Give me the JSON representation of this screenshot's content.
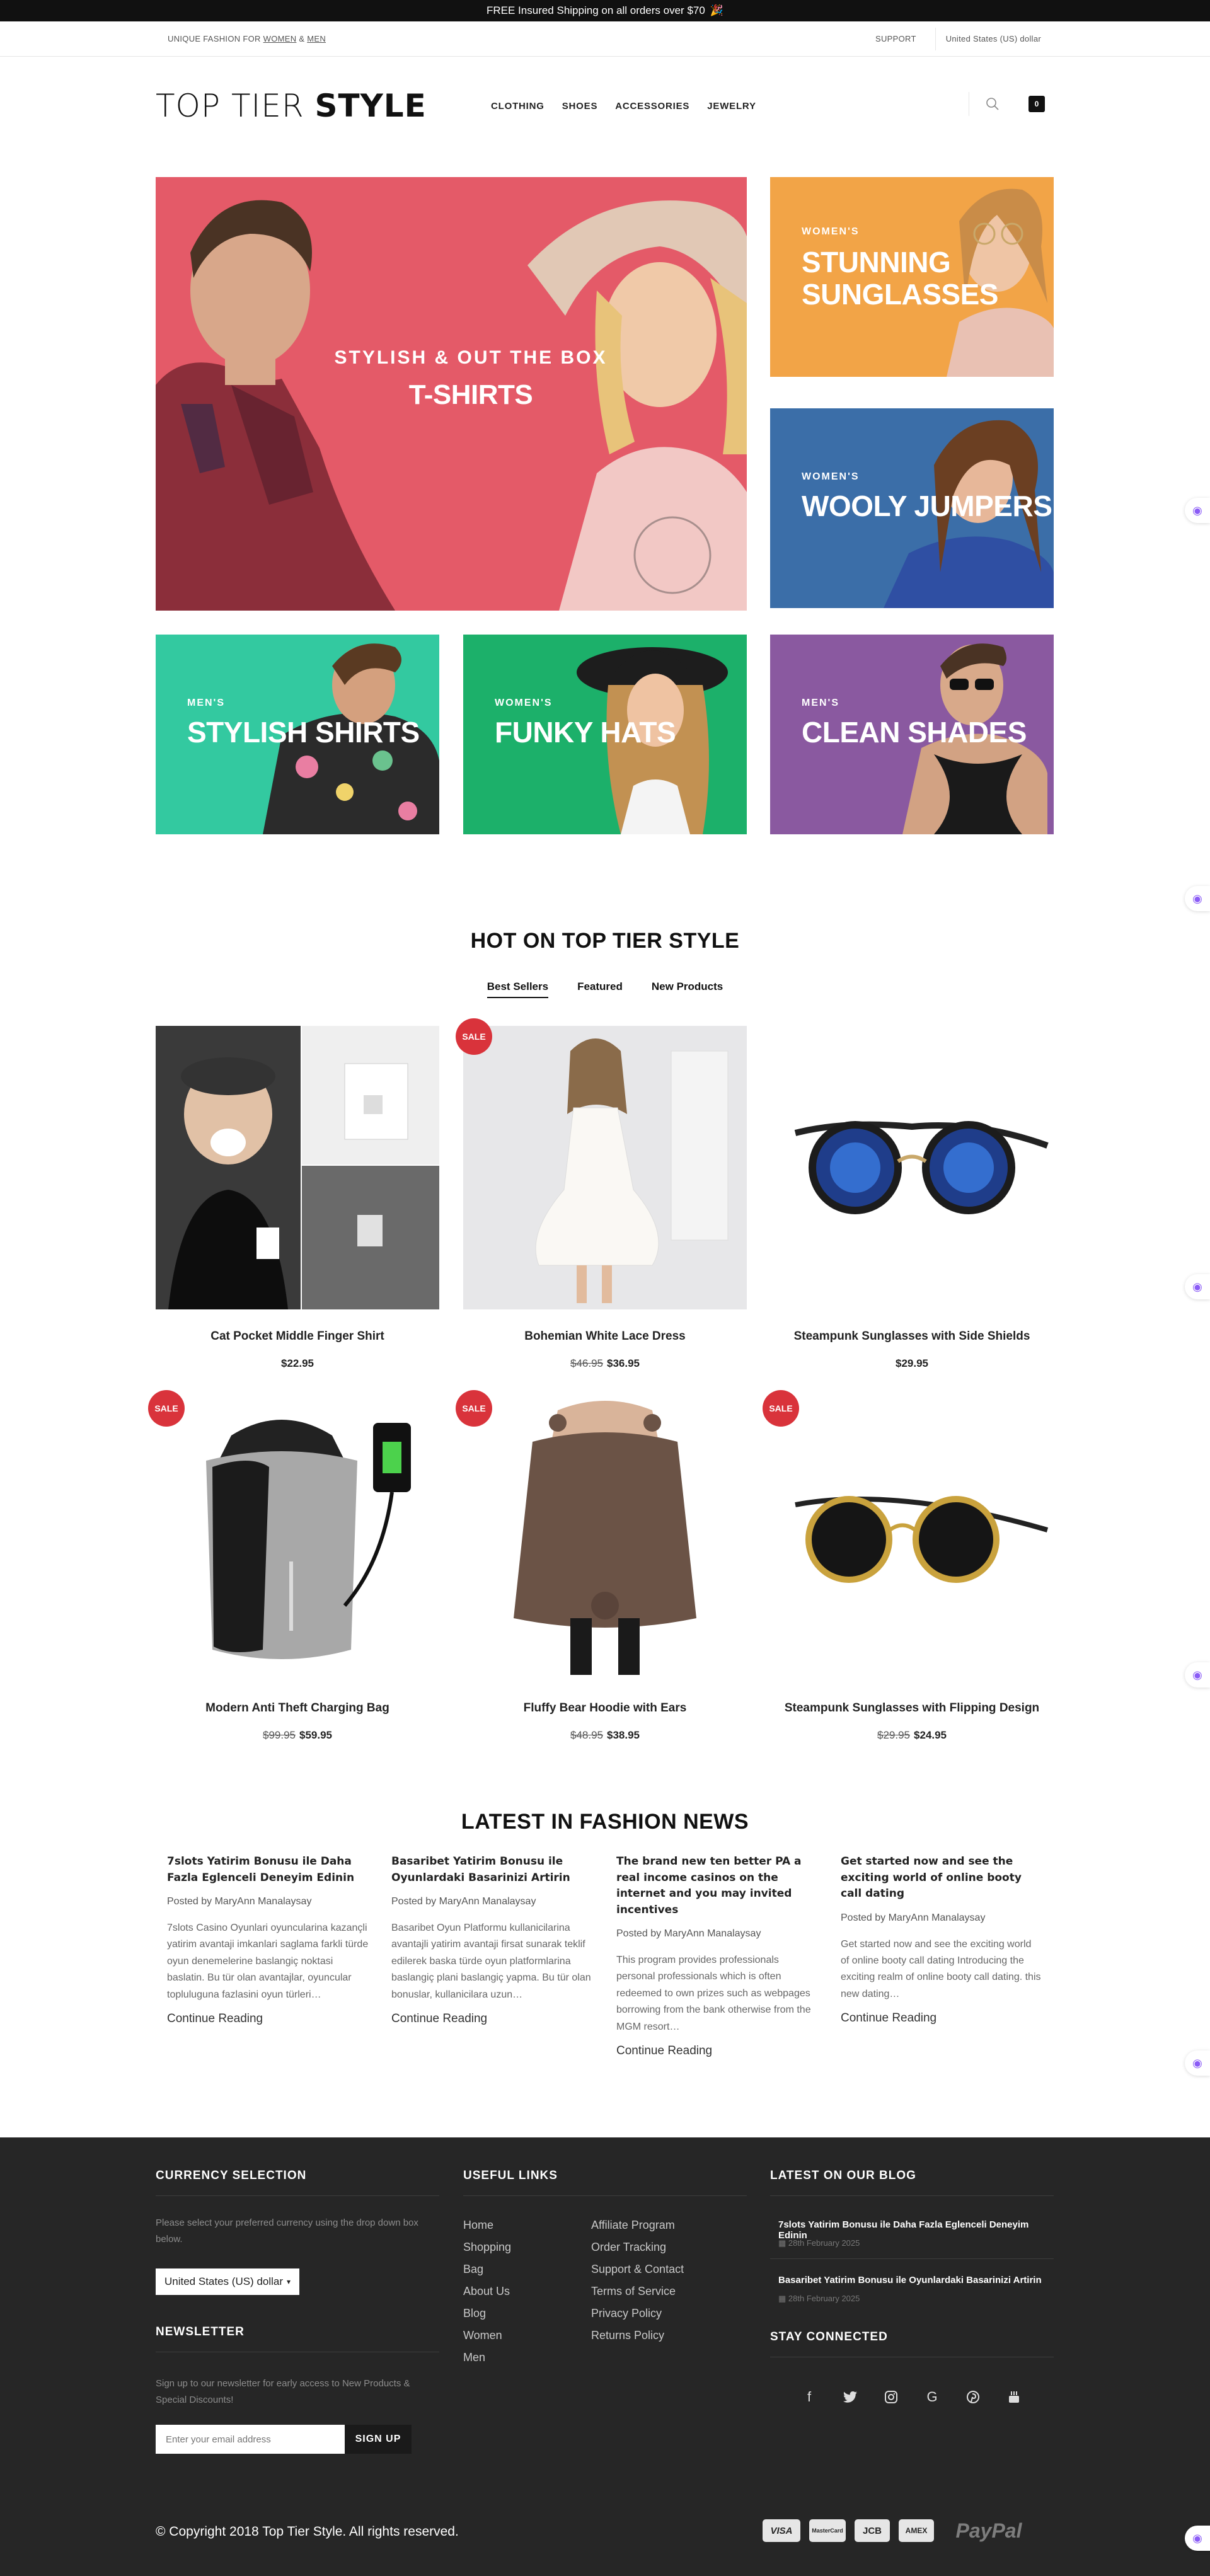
{
  "announcement": {
    "text": "FREE Insured Shipping on all orders over $70",
    "emoji": "🎉"
  },
  "utility": {
    "tagline_prefix": "UNIQUE FASHION FOR",
    "women_link": "WOMEN",
    "amp": "&",
    "men_link": "MEN",
    "support": "SUPPORT",
    "currency": "United States (US) dollar"
  },
  "header": {
    "logo_light": "TOP TIER",
    "logo_bold": "STYLE",
    "nav": [
      "CLOTHING",
      "SHOES",
      "ACCESSORIES",
      "JEWELRY"
    ],
    "cart_count": "0"
  },
  "hero": {
    "main": {
      "kicker": "STYLISH & OUT THE BOX",
      "title": "T-SHIRTS",
      "color": "#e45a68"
    },
    "tiles": [
      {
        "kicker": "WOMEN'S",
        "title_line1": "STUNNING",
        "title_line2": "SUNGLASSES",
        "color": "#f2a447"
      },
      {
        "kicker": "WOMEN'S",
        "title_line1": "WOOLY JUMPERS",
        "title_line2": "",
        "color": "#3b6ea8"
      },
      {
        "kicker": "MEN'S",
        "title_line1": "STYLISH SHIRTS",
        "title_line2": "",
        "color": "#33c9a0"
      },
      {
        "kicker": "WOMEN'S",
        "title_line1": "FUNKY HATS",
        "title_line2": "",
        "color": "#1cb06a"
      },
      {
        "kicker": "MEN'S",
        "title_line1": "CLEAN SHADES",
        "title_line2": "",
        "color": "#8a59a0"
      }
    ]
  },
  "products_section": {
    "title": "HOT ON TOP TIER STYLE",
    "tabs": [
      "Best Sellers",
      "Featured",
      "New Products"
    ],
    "sale_label": "SALE",
    "items": [
      {
        "name": "Cat Pocket Middle Finger Shirt",
        "old_price": "",
        "price": "$22.95"
      },
      {
        "name": "Bohemian White Lace Dress",
        "old_price": "$46.95",
        "price": "$36.95"
      },
      {
        "name": "Steampunk Sunglasses with Side Shields",
        "old_price": "",
        "price": "$29.95"
      },
      {
        "name": "Modern Anti Theft Charging Bag",
        "old_price": "$99.95",
        "price": "$59.95"
      },
      {
        "name": "Fluffy Bear Hoodie with Ears",
        "old_price": "$48.95",
        "price": "$38.95"
      },
      {
        "name": "Steampunk Sunglasses with Flipping Design",
        "old_price": "$29.95",
        "price": "$24.95"
      }
    ]
  },
  "news": {
    "title": "LATEST IN FASHION NEWS",
    "more_label": "Continue Reading",
    "posts": [
      {
        "title": "7slots Yatirim Bonusu ile Daha Fazla Eglenceli Deneyim Edinin",
        "author": "Posted by MaryAnn Manalaysay",
        "excerpt": "7slots Casino Oyunlari oyuncularina kazançli yatirim avantaji imkanlari saglama farkli türde oyun denemelerine baslangiç noktasi baslatin. Bu tür olan avantajlar, oyuncular topluluguna fazlasini oyun türleri…"
      },
      {
        "title": "Basaribet Yatirim Bonusu ile Oyunlardaki Basarinizi Artirin",
        "author": "Posted by MaryAnn Manalaysay",
        "excerpt": "Basaribet Oyun Platformu kullanicilarina avantajli yatirim avantaji firsat sunarak teklif edilerek baska türde oyun platformlarina baslangiç plani baslangiç yapma. Bu tür olan bonuslar, kullanicilara uzun…"
      },
      {
        "title": "The brand new ten better PA a real income casinos on the internet and you may invited incentives",
        "author": "Posted by MaryAnn Manalaysay",
        "excerpt": "This program provides professionals personal professionals which is often redeemed to own prizes such as webpages borrowing from the bank otherwise from the MGM resort…"
      },
      {
        "title": "Get started now and see the exciting world of online booty call dating",
        "author": "Posted by MaryAnn Manalaysay",
        "excerpt": "Get started now and see the exciting world of online booty call dating Introducing the exciting realm of online booty call dating. this new dating…"
      }
    ]
  },
  "footer": {
    "currency_title": "CURRENCY SELECTION",
    "currency_text": "Please select your preferred currency using the drop down box below.",
    "currency_value": "United States (US) dollar",
    "newsletter_title": "NEWSLETTER",
    "newsletter_text": "Sign up to our newsletter for early access to New Products & Special Discounts!",
    "email_placeholder": "Enter your email address",
    "signup_label": "SIGN UP",
    "links_title": "USEFUL LINKS",
    "links_col1": [
      "Home",
      "Shopping",
      "Bag",
      "About Us",
      "Blog",
      "Women",
      "Men"
    ],
    "links_col2": [
      "Affiliate Program",
      "Order Tracking",
      "Support & Contact",
      "Terms of Service",
      "Privacy Policy",
      "Returns Policy"
    ],
    "blog_title": "LATEST ON OUR BLOG",
    "blog_posts": [
      {
        "title": "7slots Yatirim Bonusu ile Daha Fazla Eglenceli Deneyim Edinin",
        "date": "28th February 2025"
      },
      {
        "title": "Basaribet Yatirim Bonusu ile Oyunlardaki Basarinizi Artirin",
        "date": "28th February 2025"
      }
    ],
    "connected_title": "STAY CONNECTED",
    "social_icons": [
      "facebook-icon",
      "twitter-icon",
      "instagram-icon",
      "google-icon",
      "pinterest-icon",
      "youtube-icon"
    ],
    "copyright": "© Copyright 2018 Top Tier Style. All rights reserved.",
    "payments": [
      "VISA",
      "MasterCard",
      "JCB",
      "AMEX",
      "PayPal"
    ]
  }
}
